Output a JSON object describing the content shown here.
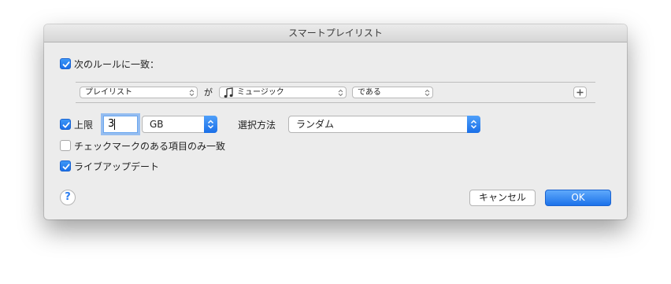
{
  "window": {
    "title": "スマートプレイリスト"
  },
  "match_rules": {
    "label": "次のルールに一致：",
    "checked": true
  },
  "rule": {
    "field": "プレイリスト",
    "connector": "が",
    "value": "ミュージック",
    "value_icon": "music-note-icon",
    "operator": "である"
  },
  "limit": {
    "label": "上限",
    "checked": true,
    "value": "3",
    "unit": "GB",
    "selected_by_label": "選択方法",
    "selected_by": "ランダム"
  },
  "checked_only": {
    "label": "チェックマークのある項目のみ一致",
    "checked": false
  },
  "live_update": {
    "label": "ライブアップデート",
    "checked": true
  },
  "buttons": {
    "help": "?",
    "cancel": "キャンセル",
    "ok": "OK"
  },
  "colors": {
    "accent": "#1a6fe8",
    "dialog_bg": "#ececec"
  }
}
